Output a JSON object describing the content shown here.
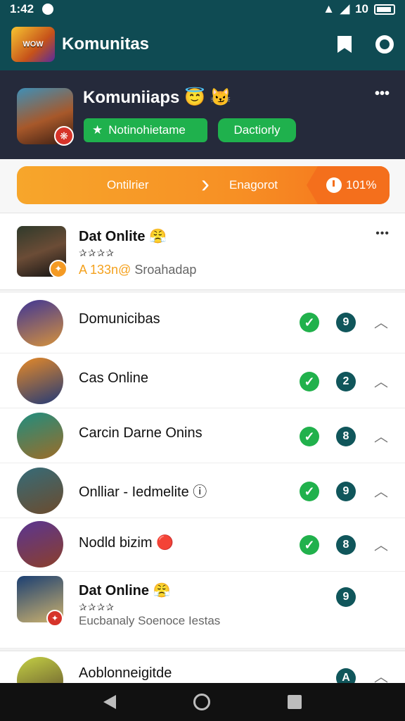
{
  "status_bar": {
    "time": "1:42",
    "battery_text": "10"
  },
  "app_bar": {
    "logo_text": "WOW",
    "title": "Komunitas",
    "bookmark_icon": "bookmark-icon",
    "settings_icon": "gear-icon"
  },
  "header": {
    "community_title": "Komuniiaps",
    "community_emoji": "😇 😼",
    "badge_symbol": "❋",
    "menu_text": "•••",
    "buttons": [
      {
        "label": "Notinohietame",
        "icon": "star-icon"
      },
      {
        "label": "Dactiorly"
      }
    ]
  },
  "progress": {
    "left_label": "Ontilrier",
    "middle_label": "Enagorot",
    "right_label": "101%",
    "accent": "#f46f1c"
  },
  "featured": {
    "name": "Dat Onlite 😤",
    "stars": "✰✰✰✰",
    "meta_number": "A 133n@",
    "meta_text": "Sroahadap",
    "more_text": "•••"
  },
  "list": {
    "items": [
      {
        "name": "Domunicibas",
        "verified": true,
        "count": "9",
        "avatar_colors": [
          "#3e3596",
          "#d6923c"
        ]
      },
      {
        "name": "Cas Online",
        "verified": true,
        "count": "2",
        "avatar_colors": [
          "#e78a27",
          "#233a77"
        ]
      },
      {
        "name": "Carcin Darne Onins",
        "verified": true,
        "count": "8",
        "avatar_colors": [
          "#1f8e80",
          "#9d6c27"
        ]
      },
      {
        "name": "Onlliar - Iedmelite ⓘ",
        "verified": true,
        "count": "9",
        "avatar_colors": [
          "#356c79",
          "#6c4b2d"
        ]
      },
      {
        "name": "Nodld bizim 🔴",
        "verified": true,
        "count": "8",
        "avatar_colors": [
          "#5a3592",
          "#8b3f2b"
        ]
      },
      {
        "name": "Dat Online 😤",
        "stars": "✰✰✰✰",
        "subtitle": "Eucbanaly Soenoce Iestas",
        "verified": false,
        "count": "9",
        "avatar_colors": [
          "#1b3f72",
          "#cdb26e"
        ]
      }
    ],
    "cutoff": {
      "name": "Aoblonneigitde",
      "count": "A"
    }
  },
  "colors": {
    "primary": "#0f4b53",
    "green": "#1fb14d",
    "orange": "#f78f24"
  }
}
